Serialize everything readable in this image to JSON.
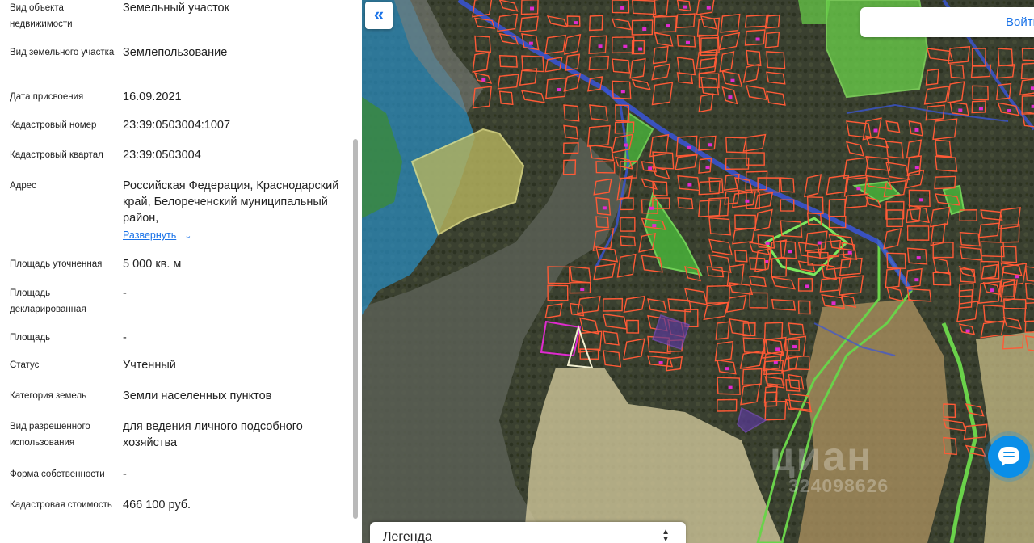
{
  "fields": [
    {
      "label": "Вид объекта недвижимости",
      "value": "Земельный участок"
    },
    {
      "label": "Вид земельного участка",
      "value": "Землепользование"
    },
    {
      "label": "Дата присвоения",
      "value": "16.09.2021"
    },
    {
      "label": "Кадастровый номер",
      "value": "23:39:0503004:1007"
    },
    {
      "label": "Кадастровый квартал",
      "value": "23:39:0503004"
    },
    {
      "label": "Адрес",
      "value": "Российская Федерация, Краснодарский край, Белореченский муниципальный район,"
    },
    {
      "label": "Площадь уточненная",
      "value": "5 000 кв. м"
    },
    {
      "label": "Площадь декларированная",
      "value": "-"
    },
    {
      "label": "Площадь",
      "value": "-"
    },
    {
      "label": "Статус",
      "value": "Учтенный"
    },
    {
      "label": "Категория земель",
      "value": "Земли населенных пунктов"
    },
    {
      "label": "Вид разрешенного использования",
      "value": "для ведения личного подсобного хозяйства"
    },
    {
      "label": "Форма собственности",
      "value": "-"
    },
    {
      "label": "Кадастровая стоимость",
      "value": "466 100 руб."
    }
  ],
  "address_expand_label": "Развернуть",
  "map": {
    "collapse_icon": "«",
    "login_label": "Войти",
    "legend_label": "Легенда",
    "watermark_brand": "циан",
    "watermark_id": "324098626"
  },
  "colors": {
    "accent": "#1a73e8",
    "parcel_outline": "#ff5a36",
    "green_zone": "#5ee04a",
    "road_blue": "#3a55d8",
    "water_blue": "#2a9fd0",
    "chat_button": "#0a8ee8"
  },
  "icons": [
    "double-chevron-left-icon",
    "chevron-down-icon",
    "sort-arrows-icon",
    "chat-icon"
  ]
}
